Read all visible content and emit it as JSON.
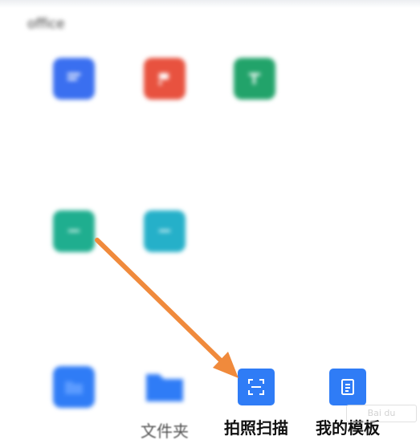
{
  "colors": {
    "word_blue": "#3a6ff0",
    "ppt_red": "#e8523f",
    "excel_green": "#22a36a",
    "app_teal": "#1fae8f",
    "app_cyan": "#25b0c9",
    "action_blue": "#2f7cf6",
    "arrow_orange": "#f08a3c"
  },
  "sections": [
    {
      "title": "office",
      "items": [
        {
          "icon": "word-doc-icon",
          "label": ""
        },
        {
          "icon": "ppt-doc-icon",
          "label": ""
        },
        {
          "icon": "excel-doc-icon",
          "label": ""
        }
      ]
    },
    {
      "title": "",
      "items": [
        {
          "icon": "app-tool-icon",
          "label": ""
        },
        {
          "icon": "image-tool-icon",
          "label": ""
        }
      ]
    },
    {
      "title": "",
      "items": [
        {
          "icon": "folder-import-icon",
          "label": ""
        },
        {
          "icon": "folder-icon",
          "label": "文件夹"
        },
        {
          "icon": "scan-icon",
          "label": "拍照扫描"
        },
        {
          "icon": "template-icon",
          "label": "我的模板"
        }
      ]
    }
  ],
  "watermark": {
    "icon": "baidu-jingyan-logo-icon"
  }
}
